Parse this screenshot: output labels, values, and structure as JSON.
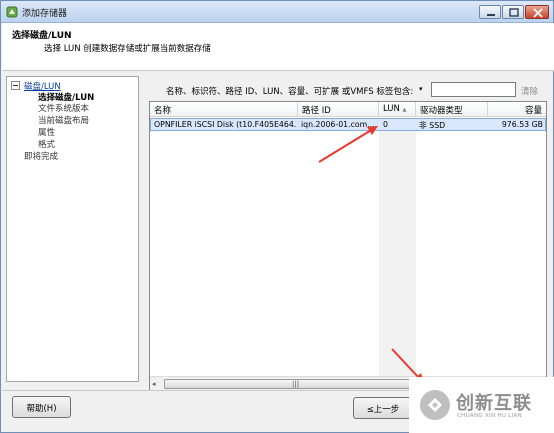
{
  "window": {
    "title": "添加存储器",
    "buttons": [
      "minimize",
      "maximize",
      "close"
    ]
  },
  "header": {
    "title": "选择磁盘/LUN",
    "subtitle": "选择 LUN 创建数据存储或扩展当前数据存储"
  },
  "nav": {
    "items": [
      {
        "label": "磁盘/LUN",
        "style": "link"
      },
      {
        "label": "选择磁盘/LUN",
        "style": "bold"
      },
      {
        "label": "文件系统版本",
        "style": "normal"
      },
      {
        "label": "当前磁盘布局",
        "style": "normal"
      },
      {
        "label": "属性",
        "style": "normal"
      },
      {
        "label": "格式",
        "style": "normal"
      },
      {
        "label": "即将完成",
        "style": "normal"
      }
    ]
  },
  "filter": {
    "label": "名称、标识符、路径 ID、LUN、容量、可扩展 或VMFS 标签包含:",
    "value": "",
    "clear_label": "清除"
  },
  "table": {
    "columns": [
      "名称",
      "路径 ID",
      "LUN",
      "驱动器类型",
      "容量"
    ],
    "sort_indicator": "▲",
    "rows": [
      {
        "name": "OPNFILER iSCSI Disk (t10.F405E464...",
        "path_id": "iqn.2006-01.com....",
        "lun": "0",
        "drive_type": "非 SSD",
        "capacity": "976.53 GB"
      }
    ]
  },
  "footer": {
    "help_label": "帮助(H)",
    "back_label": "≤上一步"
  },
  "watermark": {
    "text": "创新互联",
    "sub": "CHUANG XIN HU LIAN"
  },
  "colors": {
    "link": "#0b40a8",
    "selection": "#d8e7fb",
    "annotation_arrow": "#e8392b"
  }
}
